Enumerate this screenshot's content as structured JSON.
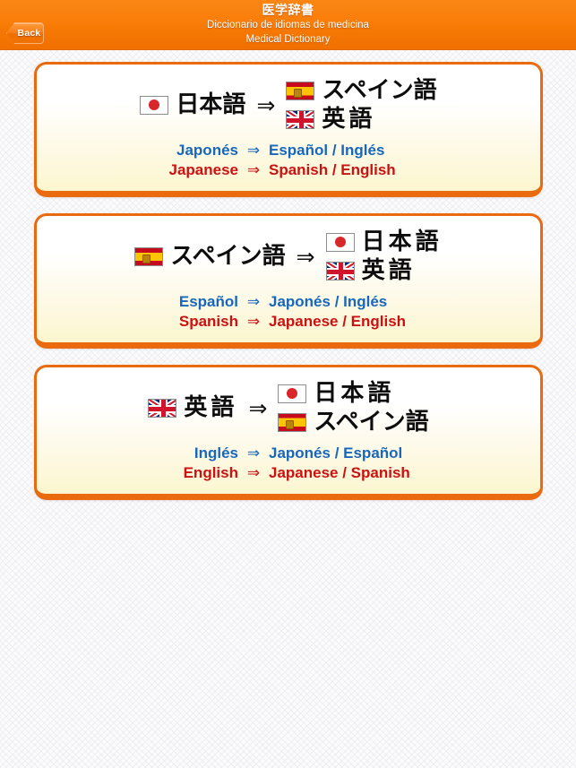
{
  "header": {
    "title_ja": "医学辞書",
    "title_es": "Diccionario de idiomas de medicina",
    "title_en": "Medical Dictionary",
    "back_label": "Back",
    "bar_color": "#f97c08"
  },
  "colors": {
    "accent_orange": "#ea6a10",
    "spanish_blue": "#1767bd",
    "english_red": "#cc1111",
    "card_top": "#ffffff",
    "card_bottom": "#fcf7cf"
  },
  "arrow": "⇒",
  "cards": [
    {
      "source": {
        "flag": "jp-flag-icon",
        "name": "日本語"
      },
      "targets": [
        {
          "flag": "es-flag-icon",
          "name": "スペイン語",
          "spaced": false
        },
        {
          "flag": "uk-flag-icon",
          "name": "英語",
          "spaced": true
        }
      ],
      "row_es": {
        "src": "Japonés",
        "tgt": "Español / Inglés"
      },
      "row_en": {
        "src": "Japanese",
        "tgt": "Spanish / English"
      }
    },
    {
      "source": {
        "flag": "es-flag-icon",
        "name": "スペイン語"
      },
      "targets": [
        {
          "flag": "jp-flag-icon",
          "name": "日本語",
          "spaced": true
        },
        {
          "flag": "uk-flag-icon",
          "name": "英語",
          "spaced": true
        }
      ],
      "row_es": {
        "src": "Español",
        "tgt": "Japonés / Inglés"
      },
      "row_en": {
        "src": "Spanish",
        "tgt": "Japanese / English"
      }
    },
    {
      "source": {
        "flag": "uk-flag-icon",
        "name": "英語"
      },
      "targets": [
        {
          "flag": "jp-flag-icon",
          "name": "日本語",
          "spaced": true
        },
        {
          "flag": "es-flag-icon",
          "name": "スペイン語",
          "spaced": false
        }
      ],
      "row_es": {
        "src": "Inglés",
        "tgt": "Japonés / Español"
      },
      "row_en": {
        "src": "English",
        "tgt": "Japanese / Spanish"
      }
    }
  ]
}
